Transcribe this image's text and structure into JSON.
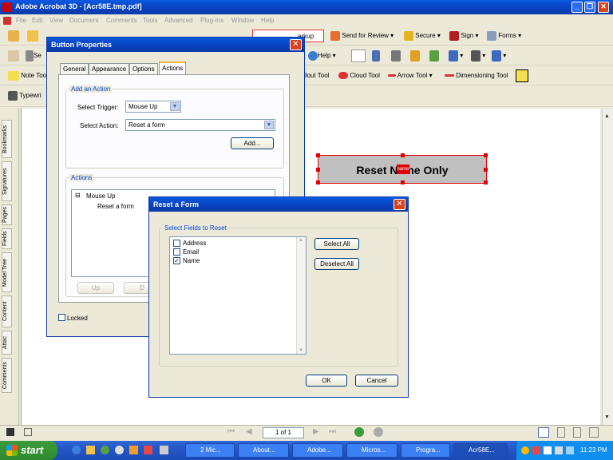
{
  "app": {
    "title": "Adobe Acrobat 3D - [Acr58E.tmp.pdf]",
    "window_buttons": {
      "minimize": "_",
      "restore": "❐",
      "close": "✕"
    }
  },
  "menu": [
    "File",
    "Edit",
    "View",
    "Document",
    "Comments",
    "Tools",
    "Advanced",
    "Plug-Ins",
    "Window",
    "Help"
  ],
  "toolbar1": {
    "markup": "arkup",
    "send_for_review": "Send for Review",
    "secure": "Secure",
    "sign": "Sign",
    "forms": "Forms"
  },
  "toolbar2": {
    "se": "Se",
    "help": "Help"
  },
  "toolbar3": {
    "note_tool": "Note Too",
    "callout_tool": "llout Tool",
    "cloud_tool": "Cloud Tool",
    "arrow_tool": "Arrow Tool",
    "dimensioning_tool": "Dimensioning Tool"
  },
  "toolbar4": {
    "typewriter": "Typewri"
  },
  "left_tabs": [
    "Bookmarks",
    "Signatures",
    "Pages",
    "Fields",
    "Model Tree",
    "Content",
    "Attac",
    "Comments"
  ],
  "form_button": {
    "label": "Reset Name Only",
    "overlay_text": "name"
  },
  "button_properties": {
    "title": "Button Properties",
    "tabs": [
      "General",
      "Appearance",
      "Options",
      "Actions"
    ],
    "active_tab": "Actions",
    "add_action_group": "Add an Action",
    "select_trigger_label": "Select Trigger:",
    "select_trigger_value": "Mouse Up",
    "select_action_label": "Select Action:",
    "select_action_value": "Reset a form",
    "add_button": "Add...",
    "actions_group": "Actions",
    "tree": {
      "trigger": "Mouse Up",
      "action": "Reset a form",
      "expander": "⊟"
    },
    "up_button": "Up",
    "down_button": "D",
    "locked_label": "Locked"
  },
  "reset_form": {
    "title": "Reset a Form",
    "group": "Select Fields to Reset",
    "fields": [
      {
        "name": "Address",
        "checked": false
      },
      {
        "name": "Email",
        "checked": false
      },
      {
        "name": "Name",
        "checked": true
      }
    ],
    "select_all": "Select All",
    "deselect_all": "Deselect All",
    "ok": "OK",
    "cancel": "Cancel"
  },
  "statusbar": {
    "page_indicator": "1 of 1"
  },
  "taskbar": {
    "start": "start",
    "items": [
      {
        "label": "2 Mic...",
        "active": false
      },
      {
        "label": "About...",
        "active": false
      },
      {
        "label": "Adobe...",
        "active": false
      },
      {
        "label": "Micros...",
        "active": false
      },
      {
        "label": "Progra...",
        "active": false
      },
      {
        "label": "Acr58E...",
        "active": true
      }
    ],
    "clock": "11:23 PM"
  }
}
